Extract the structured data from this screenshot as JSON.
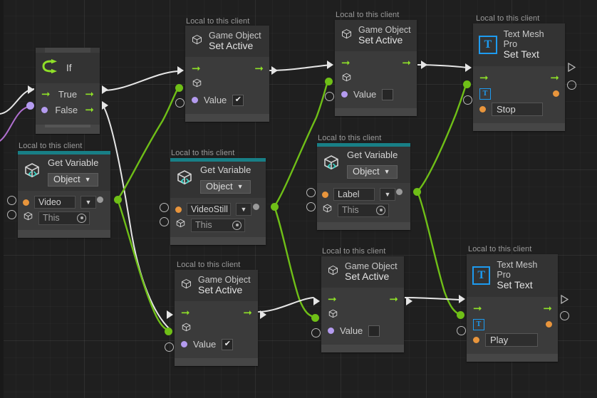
{
  "app": {
    "title": "Unity Visual Scripting Graph",
    "canvas_bg": "#1f1f1f",
    "grid_minor": "#262626",
    "grid_major": "#2b2b2b",
    "flow_accent": "#8fe028",
    "wire_flow_color": "#e6e6e6",
    "wire_value_color": "#6fbf17",
    "wire_object_color": "#b06fd0",
    "variable_accent": "#187f86",
    "tmp_blue": "#1d9bf0"
  },
  "scope_label": "Local to this client",
  "nodes": [
    {
      "id": "if",
      "kind": "flow-control",
      "title": "If",
      "icon": "branch-icon",
      "ports": [
        {
          "label": "True",
          "icon": "flow-arrow-icon"
        },
        {
          "label": "False",
          "icon": "bool-dot-icon"
        }
      ]
    },
    {
      "id": "set-active-top",
      "kind": "game-object",
      "scope": "Local to this client",
      "title_line1": "Game Object",
      "title_line2": "Set Active",
      "icon": "cube-icon",
      "value_label": "Value",
      "value_checked": true
    },
    {
      "id": "set-active-mid",
      "kind": "game-object",
      "scope": "Local to this client",
      "title_line1": "Game Object",
      "title_line2": "Set Active",
      "icon": "cube-icon",
      "value_label": "Value",
      "value_checked": false
    },
    {
      "id": "set-text-top",
      "kind": "text-mesh-pro",
      "scope": "Local to this client",
      "title_line1": "Text Mesh Pro",
      "title_line2": "Set Text",
      "icon": "tmp-icon",
      "text_value": "Stop"
    },
    {
      "id": "get-var-video",
      "kind": "get-variable",
      "scope": "Local to this client",
      "title": "Get Variable",
      "type_option": "Object",
      "icon": "variable-cube-icon",
      "variable_name": "Video",
      "source": "This"
    },
    {
      "id": "get-var-videostill",
      "kind": "get-variable",
      "scope": "Local to this client",
      "title": "Get Variable",
      "type_option": "Object",
      "icon": "variable-cube-icon",
      "variable_name": "VideoStill",
      "source": "This"
    },
    {
      "id": "get-var-label",
      "kind": "get-variable",
      "scope": "Local to this client",
      "title": "Get Variable",
      "type_option": "Object",
      "icon": "variable-cube-icon",
      "variable_name": "Label",
      "source": "This"
    },
    {
      "id": "set-active-bottom-left",
      "kind": "game-object",
      "scope": "Local to this client",
      "title_line1": "Game Object",
      "title_line2": "Set Active",
      "icon": "cube-icon",
      "value_label": "Value",
      "value_checked": true
    },
    {
      "id": "set-active-bottom-mid",
      "kind": "game-object",
      "scope": "Local to this client",
      "title_line1": "Game Object",
      "title_line2": "Set Active",
      "icon": "cube-icon",
      "value_label": "Value",
      "value_checked": false
    },
    {
      "id": "set-text-bottom",
      "kind": "text-mesh-pro",
      "scope": "Local to this client",
      "title_line1": "Text Mesh Pro",
      "title_line2": "Set Text",
      "icon": "tmp-icon",
      "text_value": "Play"
    }
  ],
  "glyphs": {
    "flow_arrow": "➡",
    "chevron_down": "▾",
    "check": "✔"
  }
}
